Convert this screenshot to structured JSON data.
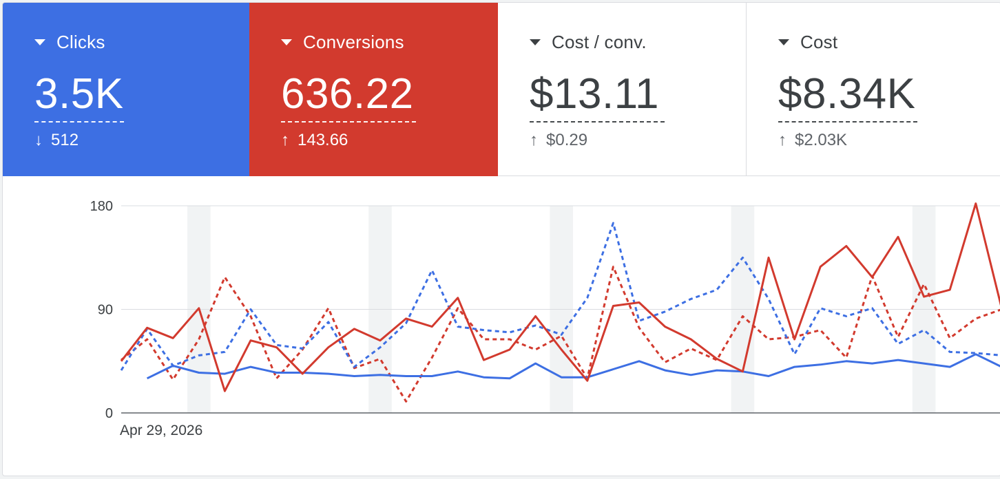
{
  "tiles": [
    {
      "label": "Clicks",
      "value": "3.5K",
      "delta_arrow": "↓",
      "delta": "512",
      "state": "selected",
      "color": "#3d6fe3"
    },
    {
      "label": "Conversions",
      "value": "636.22",
      "delta_arrow": "↑",
      "delta": "143.66",
      "state": "selected",
      "color": "#d23a2e"
    },
    {
      "label": "Cost / conv.",
      "value": "$13.11",
      "delta_arrow": "↑",
      "delta": "$0.29",
      "state": "unselected",
      "color": "#ffffff"
    },
    {
      "label": "Cost",
      "value": "$8.34K",
      "delta_arrow": "↑",
      "delta": "$2.03K",
      "state": "unselected",
      "color": "#ffffff"
    }
  ],
  "chart_data": {
    "type": "line",
    "x_start_label": "Apr 29, 2026",
    "yticks": [
      "180",
      "90",
      "0"
    ],
    "ylim": [
      0,
      180
    ],
    "grid": true,
    "weekend_bands": true,
    "series": [
      {
        "color": "#3d6fe3",
        "style": "solid",
        "values": [
          30,
          41,
          35,
          34,
          40,
          35,
          35,
          34,
          32,
          33,
          32,
          32,
          36,
          31,
          30,
          43,
          31,
          31,
          38,
          45,
          37,
          33,
          37,
          36,
          32,
          40,
          42,
          45,
          43,
          46,
          43,
          40,
          51,
          40
        ]
      },
      {
        "color": "#3d6fe3",
        "style": "dashed",
        "values": [
          37,
          73,
          41,
          50,
          53,
          90,
          59,
          56,
          79,
          40,
          57,
          78,
          124,
          75,
          72,
          70,
          76,
          68,
          100,
          165,
          80,
          88,
          99,
          107,
          135,
          99,
          51,
          91,
          84,
          91,
          60,
          72,
          53,
          52,
          50
        ]
      },
      {
        "color": "#d23a2e",
        "style": "solid",
        "values": [
          45,
          74,
          65,
          91,
          19,
          63,
          57,
          34,
          57,
          73,
          63,
          82,
          75,
          100,
          46,
          55,
          84,
          55,
          28,
          93,
          96,
          75,
          64,
          47,
          36,
          135,
          64,
          127,
          145,
          118,
          153,
          101,
          107,
          182,
          91
        ]
      },
      {
        "color": "#d23a2e",
        "style": "dashed",
        "values": [
          46,
          64,
          29,
          64,
          118,
          84,
          30,
          55,
          91,
          39,
          47,
          10,
          48,
          91,
          64,
          64,
          55,
          67,
          30,
          127,
          74,
          44,
          56,
          46,
          84,
          64,
          66,
          72,
          48,
          119,
          66,
          112,
          65,
          82,
          90
        ]
      }
    ]
  }
}
